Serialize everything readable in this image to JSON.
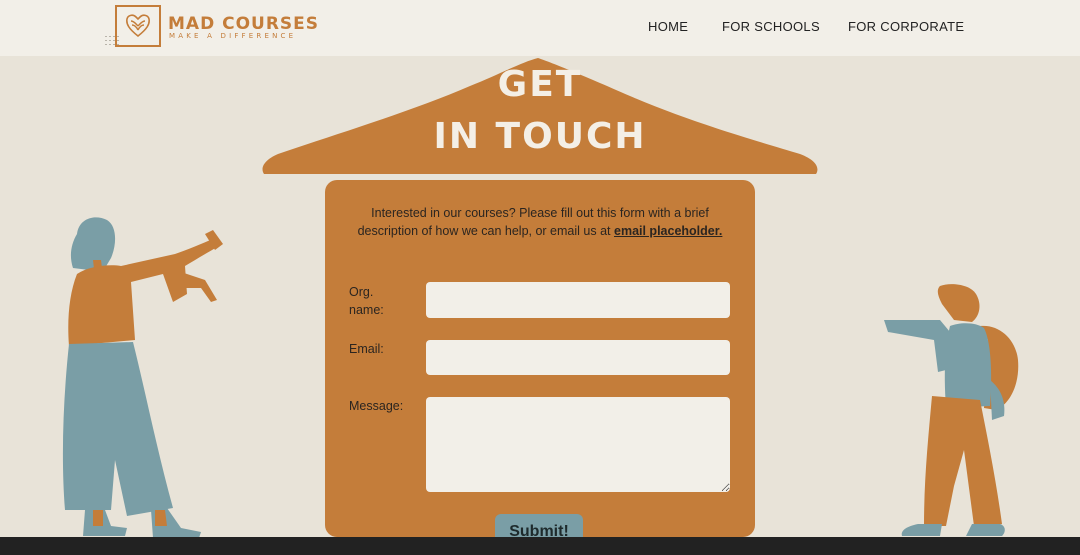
{
  "header": {
    "brand": "MAD COURSES",
    "tagline": "MAKE A DIFFERENCE",
    "nav": [
      "HOME",
      "FOR SCHOOLS",
      "FOR CORPORATE"
    ]
  },
  "hero": {
    "title_line1": "GET",
    "title_line2": "IN TOUCH"
  },
  "form": {
    "intro": "Interested in our courses? Please fill out this form with a brief description of how we can help, or email us at",
    "email_link": "email placeholder.",
    "labels": {
      "org_line1": "Org.",
      "org_line2": "name:",
      "email": "Email:",
      "message": "Message:"
    },
    "org_value": "",
    "email_value": "",
    "message_value": "",
    "submit_label": "Submit!"
  },
  "colors": {
    "accent": "#c47d3a",
    "teal": "#7a9ea6",
    "background": "#e8e3d8",
    "header_bg": "#f2efe8",
    "footer": "#222222"
  }
}
